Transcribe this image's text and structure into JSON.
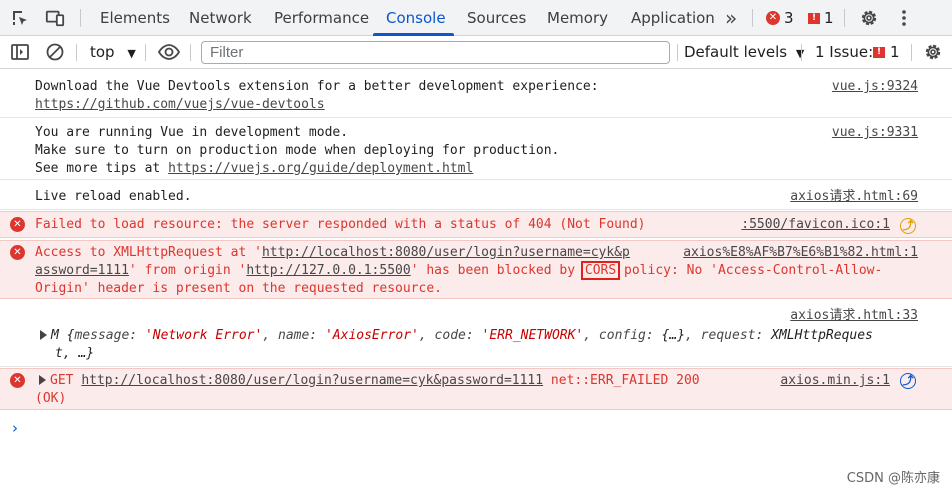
{
  "tabs": [
    {
      "label": "Elements"
    },
    {
      "label": "Network"
    },
    {
      "label": "Performance"
    },
    {
      "label": "Console"
    },
    {
      "label": "Sources"
    },
    {
      "label": "Memory"
    },
    {
      "label": "Application"
    }
  ],
  "tabbar": {
    "more_glyph": "»",
    "errors_count": "3",
    "issues_count": "1",
    "settings_icon": "gear-icon",
    "menu_icon": "kebab-menu-icon"
  },
  "toolbar": {
    "context": "top",
    "filter_placeholder": "Filter",
    "levels": "Default levels",
    "issues_label": "1 Issue:",
    "issues_count": "1"
  },
  "console": {
    "m1": {
      "line1": "Download the Vue Devtools extension for a better development experience:",
      "link": "https://github.com/vuejs/vue-devtools",
      "source": "vue.js:9324"
    },
    "m2": {
      "line1": "You are running Vue in development mode.",
      "line2": "Make sure to turn on production mode when deploying for production.",
      "line3_prefix": "See more tips at ",
      "link": "https://vuejs.org/guide/deployment.html",
      "source": "vue.js:9331"
    },
    "m3": {
      "text": "Live reload enabled.",
      "source": "axios请求.html:69"
    },
    "m4": {
      "text": "Failed to load resource: the server responded with a status of 404 (Not Found)",
      "source": ":5500/favicon.ico:1"
    },
    "m5": {
      "part1": "Access to XMLHttpRequest at '",
      "url1a": "http://localhost:8080/user/login?username=cyk&p",
      "url1b": "assword=1111",
      "part2": "' from origin '",
      "url2": "http://127.0.0.1:5500",
      "part3": "' has been blocked by ",
      "cors": "CORS",
      "part4": " policy: No 'Access-Control-Allow-",
      "line3": "Origin' header is present on the requested resource.",
      "source": "axios%E8%AF%B7%E6%B1%82.html:1"
    },
    "m6": {
      "source": "axios请求.html:33",
      "obj_prefix": "M {",
      "k1": "message: ",
      "v1": "'Network Error'",
      "k2": ", name: ",
      "v2": "'AxiosError'",
      "k3": ", code: ",
      "v3": "'ERR_NETWORK'",
      "k4": ", config: ",
      "v4": "{…}",
      "k5": ", request: ",
      "v5": "XMLHttpReques",
      "line2": "t, …}"
    },
    "m7": {
      "method": "GET ",
      "url": "http://localhost:8080/user/login?username=cyk&password=1111",
      "status": " net::ERR_FAILED 200",
      "line2": "(OK)",
      "source": "axios.min.js:1"
    },
    "watermark": "CSDN @陈亦康"
  },
  "colors": {
    "accent": "#0b57d0",
    "error": "#dc362e",
    "error_bg": "#fcebeb",
    "cors_highlight": "#e0201b"
  }
}
